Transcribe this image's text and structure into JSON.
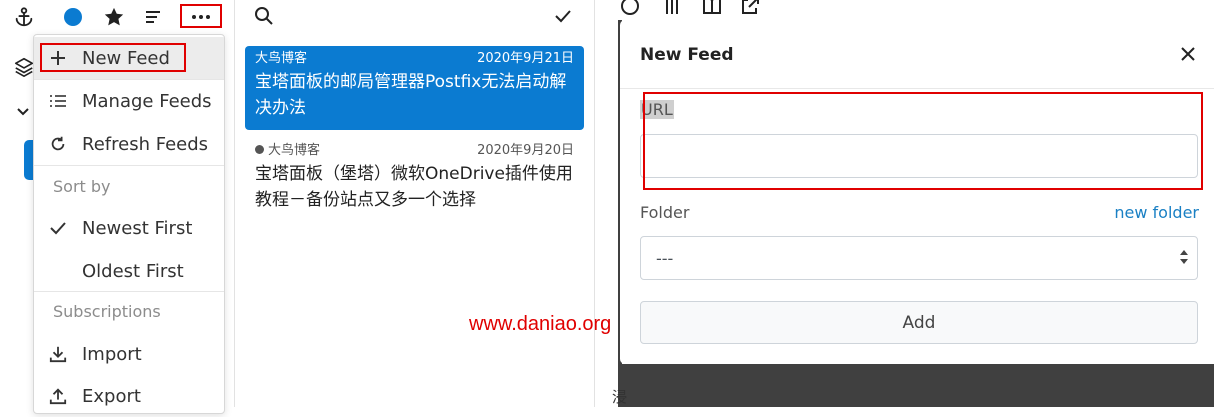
{
  "toolbar": {
    "icons": [
      "anchor-icon",
      "circle-icon",
      "star-icon",
      "list-icon",
      "more-icon"
    ],
    "accent_color": "#0b7bd1",
    "highlight_color": "#e00000"
  },
  "menu": {
    "new_feed": "New Feed",
    "manage_feeds": "Manage Feeds",
    "refresh_feeds": "Refresh Feeds",
    "sort_by_header": "Sort by",
    "newest_first": "Newest First",
    "oldest_first": "Oldest First",
    "subscriptions_header": "Subscriptions",
    "import": "Import",
    "export": "Export"
  },
  "articles": [
    {
      "source": "大鸟博客",
      "date": "2020年9月21日",
      "title": "宝塔面板的邮局管理器Postfix无法启动解决办法",
      "selected": true
    },
    {
      "source": "大鸟博客",
      "date": "2020年9月20日",
      "title": "宝塔面板（堡塔）微软OneDrive插件使用教程－备份站点又多一个选择",
      "selected": false
    }
  ],
  "modal": {
    "title": "New Feed",
    "url_label": "URL",
    "url_value": "",
    "folder_label": "Folder",
    "new_folder_link": "new folder",
    "folder_value": "---",
    "add_button": "Add"
  },
  "watermark": "www.daniao.org",
  "bottom_char": "浸"
}
